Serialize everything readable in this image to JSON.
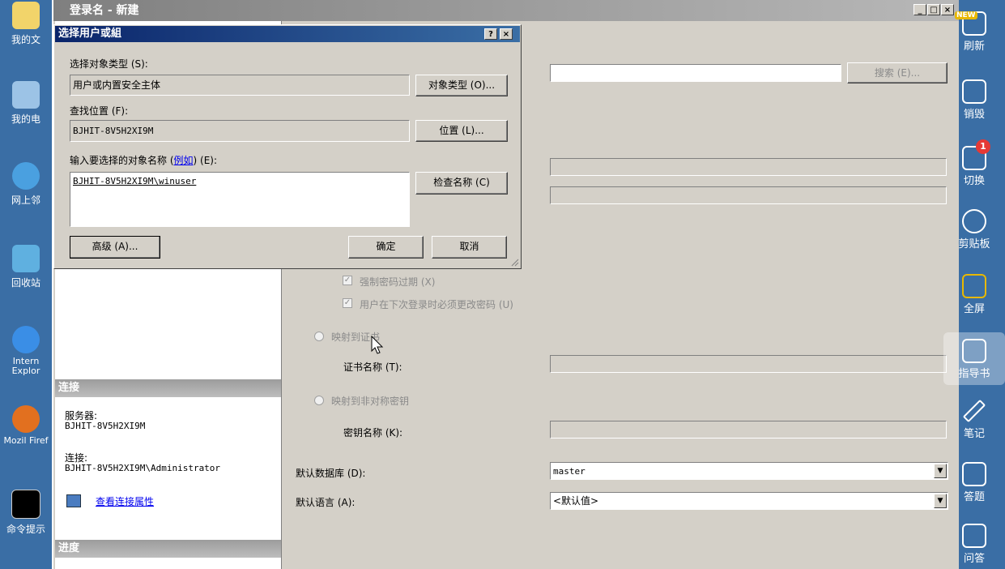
{
  "desktop": {
    "icons": [
      {
        "label": "我的文",
        "name": "my-documents"
      },
      {
        "label": "我的电",
        "name": "my-computer"
      },
      {
        "label": "网上邻",
        "name": "network-places"
      },
      {
        "label": "回收站",
        "name": "recycle-bin"
      },
      {
        "label": "Intern Explor",
        "name": "internet-explorer"
      },
      {
        "label": "Mozil Firef",
        "name": "mozilla-firefox"
      },
      {
        "label": "命令提示",
        "name": "command-prompt"
      }
    ]
  },
  "main_window": {
    "title": "登录名 - 新建",
    "caption_buttons": {
      "minimize": "_",
      "maximize": "□",
      "close": "×"
    },
    "search_button": "搜索 (E)...",
    "connection": {
      "header": "连接",
      "server_label": "服务器:",
      "server_value": "BJHIT-8V5H2XI9M",
      "conn_label": "连接:",
      "conn_value": "BJHIT-8V5H2XI9M\\Administrator",
      "view_props_link": "查看连接属性"
    },
    "progress_header": "进度",
    "enforce_expiration": "强制密码过期 (X)",
    "must_change": "用户在下次登录时必须更改密码 (U)",
    "map_cert": "映射到证书",
    "cert_name_label": "证书名称 (T):",
    "map_asym": "映射到非对称密钥",
    "key_name_label": "密钥名称 (K):",
    "default_db_label": "默认数据库 (D):",
    "default_db_value": "master",
    "default_lang_label": "默认语言 (A):",
    "default_lang_value": "<默认值>"
  },
  "dialog": {
    "title": "选择用户或組",
    "help_btn": "?",
    "close_btn": "×",
    "object_type_label": "选择对象类型 (S):",
    "object_type_value": "用户或内置安全主体",
    "object_type_button": "对象类型 (O)...",
    "location_label": "查找位置 (F):",
    "location_value": "BJHIT-8V5H2XI9M",
    "location_button": "位置 (L)...",
    "enter_names_label_prefix": "输入要选择的对象名称 (",
    "enter_names_link": "例如",
    "enter_names_label_suffix": ") (E):",
    "enter_names_value": "BJHIT-8V5H2XI9M\\winuser",
    "check_names_button": "检查名称 (C)",
    "advanced_button": "高级 (A)...",
    "ok_button": "确定",
    "cancel_button": "取消"
  },
  "sidebar": {
    "items": [
      {
        "label": "刷新",
        "name": "refresh",
        "badge": "NEW"
      },
      {
        "label": "销毁",
        "name": "destroy"
      },
      {
        "label": "切换",
        "name": "switch",
        "badge": "1"
      },
      {
        "label": "剪贴板",
        "name": "clipboard"
      },
      {
        "label": "全屏",
        "name": "fullscreen"
      },
      {
        "label": "指导书",
        "name": "guide"
      },
      {
        "label": "笔记",
        "name": "notes"
      },
      {
        "label": "答题",
        "name": "answer"
      },
      {
        "label": "问答",
        "name": "qa"
      }
    ]
  },
  "colors": {
    "desktop_bg": "#3a6ea5",
    "dialog_title": "#0a246a",
    "window_face": "#d4d0c8"
  }
}
